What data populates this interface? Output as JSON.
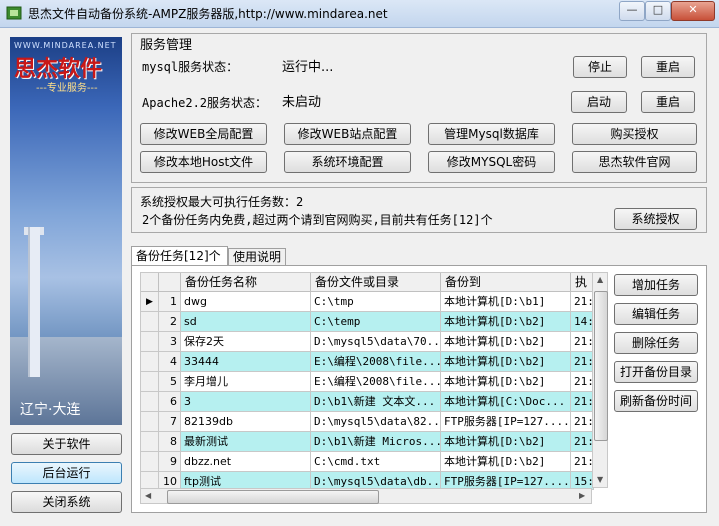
{
  "window": {
    "title": "思杰文件自动备份系统-AMPZ服务器版,http://www.mindarea.net",
    "minimize": "—",
    "maximize": "□",
    "close": "✕"
  },
  "banner": {
    "site": "WWW.MINDAREA.NET",
    "brand": "思杰软件",
    "slogan": "---专业服务---",
    "signature": "辽宁·大连"
  },
  "side_buttons": {
    "about": "关于软件",
    "background": "后台运行",
    "close_system": "关闭系统"
  },
  "service": {
    "section_title": "服务管理",
    "mysql_label": "mysql服务状态：",
    "mysql_status": "运行中...",
    "apache_label": "Apache2.2服务状态：",
    "apache_status": "未启动",
    "stop": "停止",
    "restart1": "重启",
    "start": "启动",
    "restart2": "重启",
    "buttons": [
      "修改WEB全局配置",
      "修改WEB站点配置",
      "管理Mysql数据库",
      "购买授权",
      "修改本地Host文件",
      "系统环境配置",
      "修改MYSQL密码",
      "思杰软件官网"
    ]
  },
  "license": {
    "line1": "系统授权最大可执行任务数：2",
    "line2": "2个备份任务内免费,超过两个请到官网购买,目前共有任务[12]个",
    "button": "系统授权"
  },
  "tabs": [
    "备份任务[12]个",
    "使用说明"
  ],
  "grid": {
    "headers": [
      "备份任务名称",
      "备份文件或目录",
      "备份到",
      "执"
    ],
    "rows": [
      {
        "n": "1",
        "name": "dwg",
        "src": "C:\\tmp",
        "dest": "本地计算机[D:\\b1]",
        "exec": "21:"
      },
      {
        "n": "2",
        "name": "sd",
        "src": "C:\\temp",
        "dest": "本地计算机[D:\\b2]",
        "exec": "14:"
      },
      {
        "n": "3",
        "name": "保存2天",
        "src": "D:\\mysql5\\data\\70...",
        "dest": "本地计算机[D:\\b2]",
        "exec": "21:"
      },
      {
        "n": "4",
        "name": "33444",
        "src": "E:\\编程\\2008\\file...",
        "dest": "本地计算机[D:\\b2]",
        "exec": "21:"
      },
      {
        "n": "5",
        "name": "李月增儿",
        "src": "E:\\编程\\2008\\file...",
        "dest": "本地计算机[D:\\b2]",
        "exec": "21:"
      },
      {
        "n": "6",
        "name": "3",
        "src": "D:\\b1\\新建 文本文...",
        "dest": "本地计算机[C:\\Doc...",
        "exec": "21:"
      },
      {
        "n": "7",
        "name": "82139db",
        "src": "D:\\mysql5\\data\\82...",
        "dest": "FTP服务器[IP=127....",
        "exec": "21:"
      },
      {
        "n": "8",
        "name": "最新测试",
        "src": "D:\\b1\\新建 Micros...",
        "dest": "本地计算机[D:\\b2]",
        "exec": "21:"
      },
      {
        "n": "9",
        "name": "dbzz.net",
        "src": "C:\\cmd.txt",
        "dest": "本地计算机[D:\\b2]",
        "exec": "21:"
      },
      {
        "n": "10",
        "name": "ftp测试",
        "src": "D:\\mysql5\\data\\db...",
        "dest": "FTP服务器[IP=127....",
        "exec": "15:"
      }
    ]
  },
  "task_buttons": [
    "增加任务",
    "编辑任务",
    "删除任务",
    "打开备份目录",
    "刷新备份时间"
  ]
}
